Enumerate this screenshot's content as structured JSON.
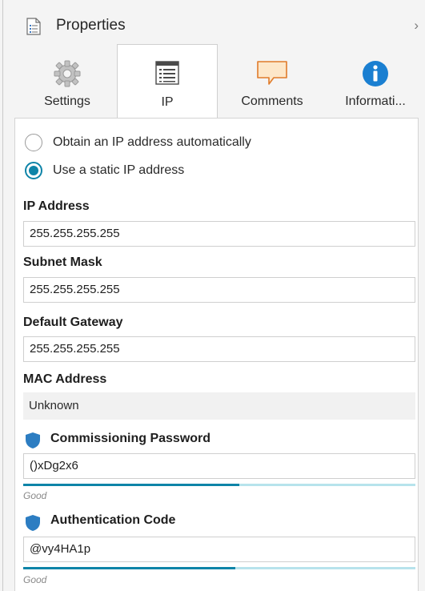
{
  "header": {
    "title": "Properties"
  },
  "tabs": [
    {
      "label": "Settings",
      "icon": "gear-icon"
    },
    {
      "label": "IP",
      "icon": "network-list-icon",
      "active": true
    },
    {
      "label": "Comments",
      "icon": "comment-icon"
    },
    {
      "label": "Informati...",
      "icon": "info-icon"
    }
  ],
  "ip": {
    "radio_auto": {
      "label": "Obtain an IP address automatically",
      "checked": false
    },
    "radio_static": {
      "label": "Use a static IP address",
      "checked": true
    },
    "ip_address": {
      "label": "IP Address",
      "value": "255.255.255.255"
    },
    "subnet_mask": {
      "label": "Subnet Mask",
      "value": "255.255.255.255"
    },
    "default_gateway": {
      "label": "Default Gateway",
      "value": "255.255.255.255"
    },
    "mac_address": {
      "label": "MAC Address",
      "value": "Unknown"
    },
    "commissioning_password": {
      "label": "Commissioning Password",
      "value": "()xDg2x6",
      "strength_text": "Good",
      "strength": 0.55
    },
    "authentication_code": {
      "label": "Authentication Code",
      "value": "@vy4HA1p",
      "strength_text": "Good",
      "strength": 0.54
    }
  },
  "colors": {
    "accent": "#0e84a8",
    "meter_track": "#b7e3ec",
    "info_blue": "#1a7fd1",
    "comment_orange": "#e07b2a"
  }
}
